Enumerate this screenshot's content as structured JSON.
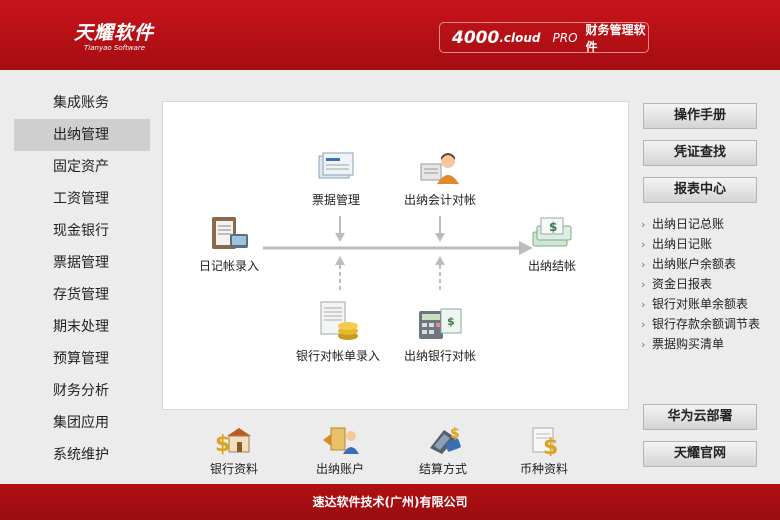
{
  "header": {
    "logo_cn": "天耀软件",
    "logo_en": "Tianyao Software",
    "version": "4000",
    "cloud": ".cloud",
    "edition": "PRO",
    "product_name": "财务管理软件"
  },
  "nav": {
    "items": [
      {
        "label": "集成账务"
      },
      {
        "label": "出纳管理"
      },
      {
        "label": "固定资产"
      },
      {
        "label": "工资管理"
      },
      {
        "label": "现金银行"
      },
      {
        "label": "票据管理"
      },
      {
        "label": "存货管理"
      },
      {
        "label": "期末处理"
      },
      {
        "label": "预算管理"
      },
      {
        "label": "财务分析"
      },
      {
        "label": "集团应用"
      },
      {
        "label": "系统维护"
      }
    ],
    "active": "出纳管理"
  },
  "flow": {
    "journal_entry": "日记帐录入",
    "bill_management": "票据管理",
    "cashier_accounting_reconcile": "出纳会计对帐",
    "cashier_close": "出纳结帐",
    "bank_statement_entry": "银行对帐单录入",
    "cashier_bank_reconcile": "出纳银行对帐"
  },
  "quick_links": {
    "bank_info": "银行资料",
    "cashier_account": "出纳账户",
    "settlement_method": "结算方式",
    "currency_info": "币种资料"
  },
  "right": {
    "manual": "操作手册",
    "voucher_search": "凭证查找",
    "report_center": "报表中心",
    "reports": [
      "出纳日记总账",
      "出纳日记账",
      "出纳账户余额表",
      "资金日报表",
      "银行对账单余额表",
      "银行存款余额调节表",
      "票据购买清单"
    ],
    "huawei": "华为云部署",
    "official_site": "天耀官网"
  },
  "footer": {
    "company": "速达软件技术(广州)有限公司"
  },
  "colors": {
    "brand_red": "#b10f14",
    "active_nav": "#cfcfcf",
    "panel_bg": "#ffffff",
    "page_bg": "#ececec"
  }
}
